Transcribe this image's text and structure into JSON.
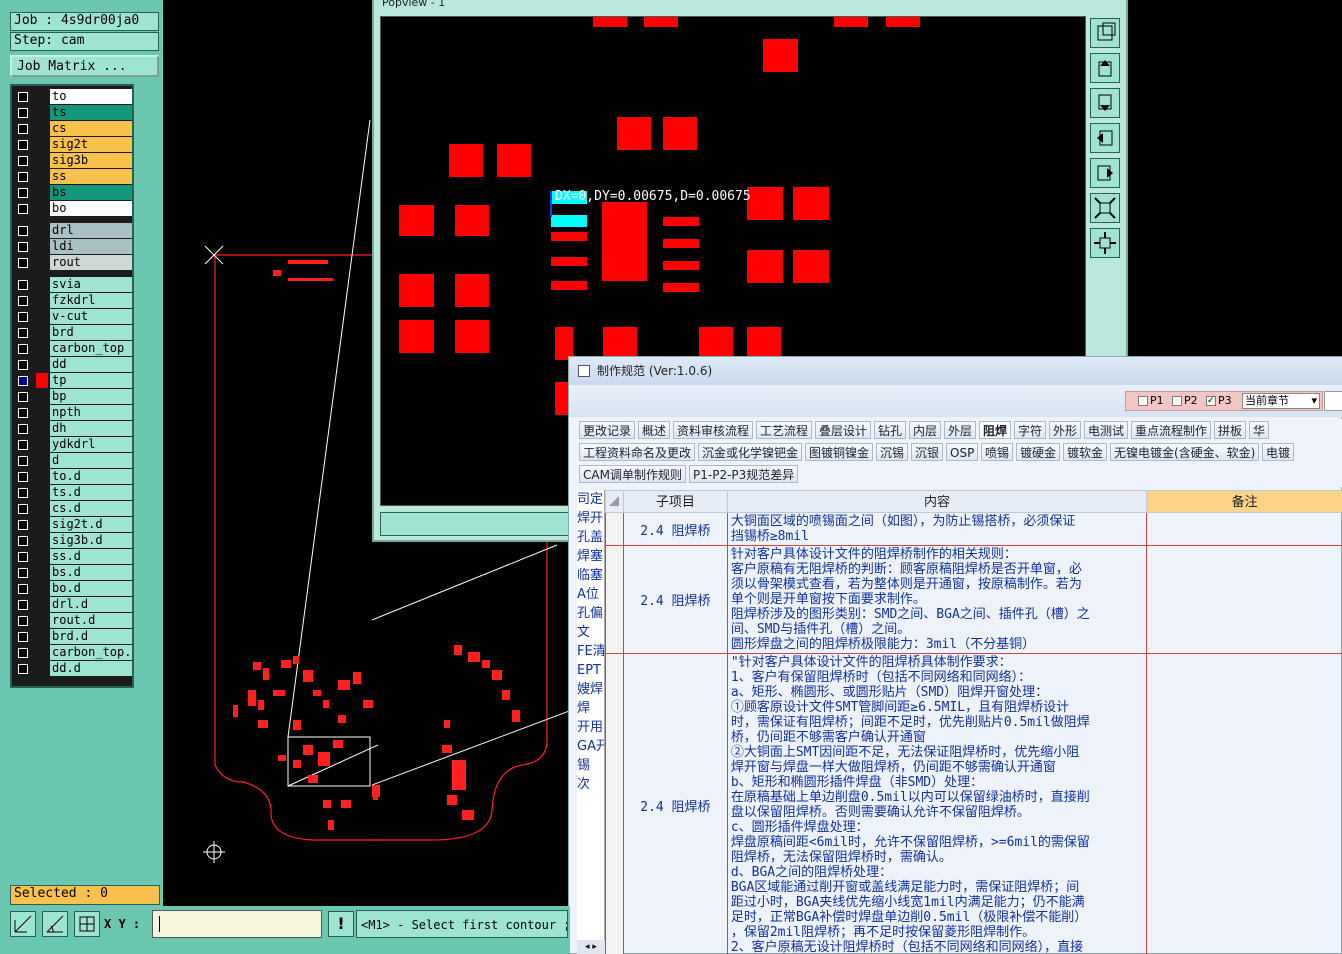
{
  "job": {
    "label": "Job : 4s9dr00ja0",
    "step": "Step: cam",
    "matrix_button": "Job Matrix ..."
  },
  "layers": [
    {
      "name": "to",
      "color": "#ffffff",
      "checked": false
    },
    {
      "name": "ts",
      "color": "#14967a",
      "checked": false
    },
    {
      "name": "cs",
      "color": "#f7c14c",
      "checked": false
    },
    {
      "name": "sig2t",
      "color": "#f7c14c",
      "checked": false
    },
    {
      "name": "sig3b",
      "color": "#f7c14c",
      "checked": false
    },
    {
      "name": "ss",
      "color": "#f7c14c",
      "checked": false
    },
    {
      "name": "bs",
      "color": "#14967a",
      "checked": false
    },
    {
      "name": "bo",
      "color": "#ffffff",
      "checked": false
    },
    {
      "name": "drl",
      "color": "#a9c0c4",
      "checked": false
    },
    {
      "name": "ldi",
      "color": "#a9c0c4",
      "checked": false
    },
    {
      "name": "rout",
      "color": "#cfd6d6",
      "checked": false
    },
    {
      "name": "svia",
      "color": "#9fe3d2",
      "checked": false
    },
    {
      "name": "fzkdrl",
      "color": "#9fe3d2",
      "checked": false
    },
    {
      "name": "v-cut",
      "color": "#9fe3d2",
      "checked": false
    },
    {
      "name": "brd",
      "color": "#9fe3d2",
      "checked": false
    },
    {
      "name": "carbon_top",
      "color": "#9fe3d2",
      "checked": false
    },
    {
      "name": "dd",
      "color": "#9fe3d2",
      "checked": false
    },
    {
      "name": "tp",
      "color": "#9fe3d2",
      "checked": true,
      "swatch": "#ff0000"
    },
    {
      "name": "bp",
      "color": "#9fe3d2",
      "checked": false
    },
    {
      "name": "npth",
      "color": "#9fe3d2",
      "checked": false
    },
    {
      "name": "dh",
      "color": "#9fe3d2",
      "checked": false
    },
    {
      "name": "ydkdrl",
      "color": "#9fe3d2",
      "checked": false
    },
    {
      "name": "d",
      "color": "#9fe3d2",
      "checked": false
    },
    {
      "name": "to.d",
      "color": "#9fe3d2",
      "checked": false
    },
    {
      "name": "ts.d",
      "color": "#9fe3d2",
      "checked": false
    },
    {
      "name": "cs.d",
      "color": "#9fe3d2",
      "checked": false
    },
    {
      "name": "sig2t.d",
      "color": "#9fe3d2",
      "checked": false
    },
    {
      "name": "sig3b.d",
      "color": "#9fe3d2",
      "checked": false
    },
    {
      "name": "ss.d",
      "color": "#9fe3d2",
      "checked": false
    },
    {
      "name": "bs.d",
      "color": "#9fe3d2",
      "checked": false
    },
    {
      "name": "bo.d",
      "color": "#9fe3d2",
      "checked": false
    },
    {
      "name": "drl.d",
      "color": "#9fe3d2",
      "checked": false
    },
    {
      "name": "rout.d",
      "color": "#9fe3d2",
      "checked": false
    },
    {
      "name": "brd.d",
      "color": "#9fe3d2",
      "checked": false
    },
    {
      "name": "carbon_top.d",
      "color": "#9fe3d2",
      "checked": false
    },
    {
      "name": "dd.d",
      "color": "#9fe3d2",
      "checked": false
    }
  ],
  "status": {
    "selected": "Selected : 0",
    "xy_label": "X Y :",
    "xy_value": "",
    "message": "<M1> - Select first contour ;"
  },
  "popview": {
    "title": "Popview - 1",
    "measure": "DX=0,DY=0.00675,D=0.00675"
  },
  "spec": {
    "title": "制作规范 (Ver:1.0.6)",
    "options": {
      "p1": "P1",
      "p2": "P2",
      "p3": "P3",
      "p3_checked": true,
      "scope": "当前章节"
    },
    "tabs_row1": [
      "更改记录",
      "概述",
      "资料审核流程",
      "工艺流程",
      "叠层设计",
      "钻孔",
      "内层",
      "外层",
      "阻焊",
      "字符",
      "外形",
      "电测试",
      "重点流程制作",
      "拼板",
      "华"
    ],
    "tabs_row2": [
      "工程资料命名及更改",
      "沉金或化学镍钯金",
      "图镀铜镍金",
      "沉锡",
      "沉银",
      "OSP",
      "喷锡",
      "镀硬金",
      "镀软金",
      "无镍电镀金(含硬金、软金)",
      "电镀"
    ],
    "tabs_row3": [
      "CAM调单制作规则",
      "P1-P2-P3规范差异"
    ],
    "active_tab": "阻焊",
    "left_strip": [
      "司定",
      "焊开",
      "孔盖",
      "焊塞",
      "临塞",
      "A位",
      "孔偏",
      "文",
      "FE清",
      "EPT",
      "嫂焊",
      "焊",
      "开用",
      "GA开",
      "锡",
      "次"
    ],
    "headers": {
      "sub": "子项目",
      "content": "内容",
      "note": "备注"
    },
    "rows": [
      {
        "sub": "2.4 阻焊桥",
        "content": [
          "大铜面区域的喷锡面之间（如图），为防止锡搭桥，必须保证",
          "挡锡桥≥8mil"
        ],
        "note": ""
      },
      {
        "sub": "2.4 阻焊桥",
        "content": [
          "针对客户具体设计文件的阻焊桥制作的相关规则：",
          "客户原稿有无阻焊桥的判断：顾客原稿阻焊桥是否开单窗，必",
          "须以骨架模式查看，若为整体则是开通窗，按原稿制作。若为",
          "单个则是开单窗按下面要求制作。",
          "阻焊桥涉及的图形类别：SMD之间、BGA之间、插件孔（槽）之",
          "间、SMD与插件孔（槽）之间。",
          "圆形焊盘之间的阻焊桥极限能力：3mil（不分基铜）"
        ],
        "note": ""
      },
      {
        "sub": "2.4 阻焊桥",
        "content": [
          "\"针对客户具体设计文件的阻焊桥具体制作要求：",
          "1、客户有保留阻焊桥时（包括不同网络和同网络）：",
          "a、矩形、椭圆形、或圆形贴片（SMD）阻焊开窗处理：",
          "①顾客原设计文件SMT管脚间距≥6.5MIL，且有阻焊桥设计",
          "时，需保证有阻焊桥；间距不足时，优先削贴片0.5mil做阻焊",
          "桥，仍间距不够需客户确认开通窗",
          "②大铜面上SMT因间距不足，无法保证阻焊桥时，优先缩小阻",
          "焊开窗与焊盘一样大做阻焊桥，仍间距不够需确认开通窗",
          "b、矩形和椭圆形插件焊盘（非SMD）处理：",
          "在原稿基础上单边削盘0.5mil以内可以保留绿油桥时，直接削",
          "盘以保留阻焊桥。否则需要确认允许不保留阻焊桥。",
          "c、圆形插件焊盘处理：",
          "焊盘原稿间距<6mil时，允许不保留阻焊桥，>=6mil的需保留",
          "阻焊桥，无法保留阻焊桥时，需确认。",
          "d、BGA之间的阻焊桥处理：",
          "BGA区域能通过削开窗或盖线满足能力时，需保证阻焊桥；间",
          "距过小时，BGA夹线优先缩小线宽1mil内满足能力；仍不能满",
          "足时，正常BGA补偿时焊盘单边削0.5mil（极限补偿不能削）",
          "，保留2mil阻焊桥；再不足时按保留菱形阻焊制作。",
          "2、客户原稿无设计阻焊桥时（包括不同网络和同网络），直接"
        ],
        "note": ""
      }
    ]
  }
}
